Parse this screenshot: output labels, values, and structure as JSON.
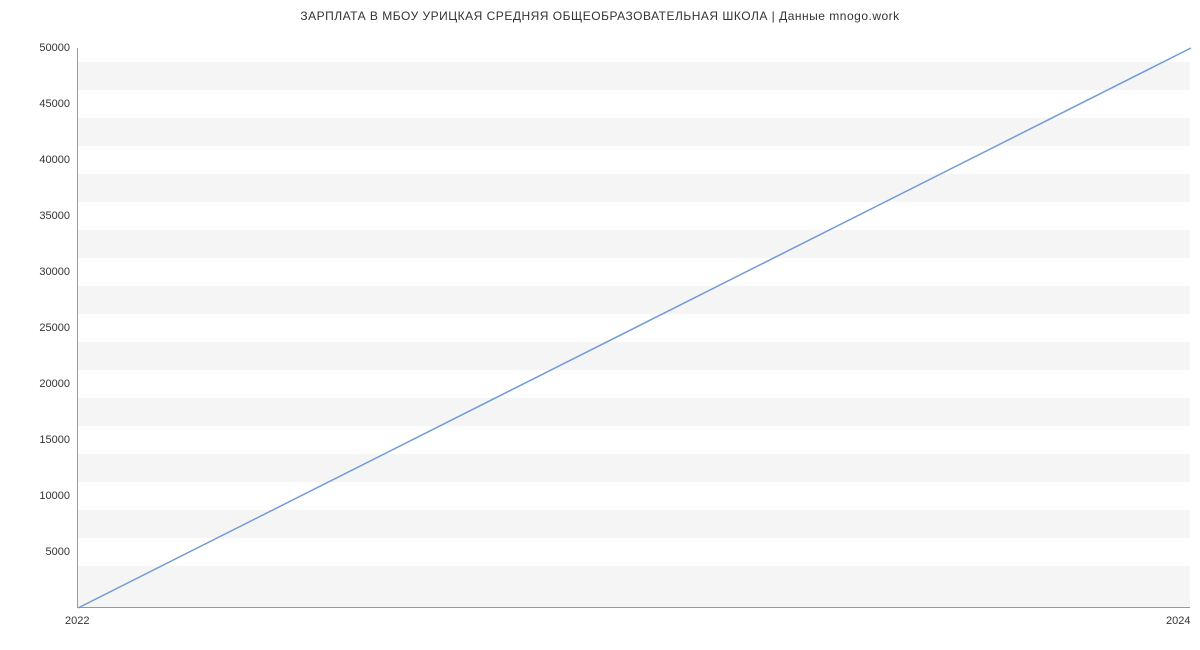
{
  "chart_data": {
    "type": "line",
    "title": "ЗАРПЛАТА В МБОУ УРИЦКАЯ СРЕДНЯЯ ОБЩЕОБРАЗОВАТЕЛЬНАЯ ШКОЛА | Данные mnogo.work",
    "xlabel": "",
    "ylabel": "",
    "x": [
      2022,
      2024
    ],
    "y": [
      0,
      50000
    ],
    "x_ticks": [
      2022,
      2024
    ],
    "y_ticks": [
      5000,
      10000,
      15000,
      20000,
      25000,
      30000,
      35000,
      40000,
      45000,
      50000
    ],
    "xlim": [
      2022,
      2024
    ],
    "ylim": [
      0,
      50000
    ],
    "line_color": "#6f9bd8",
    "plot_bg": "#f5f5f5",
    "grid_stripe": "#ffffff"
  }
}
